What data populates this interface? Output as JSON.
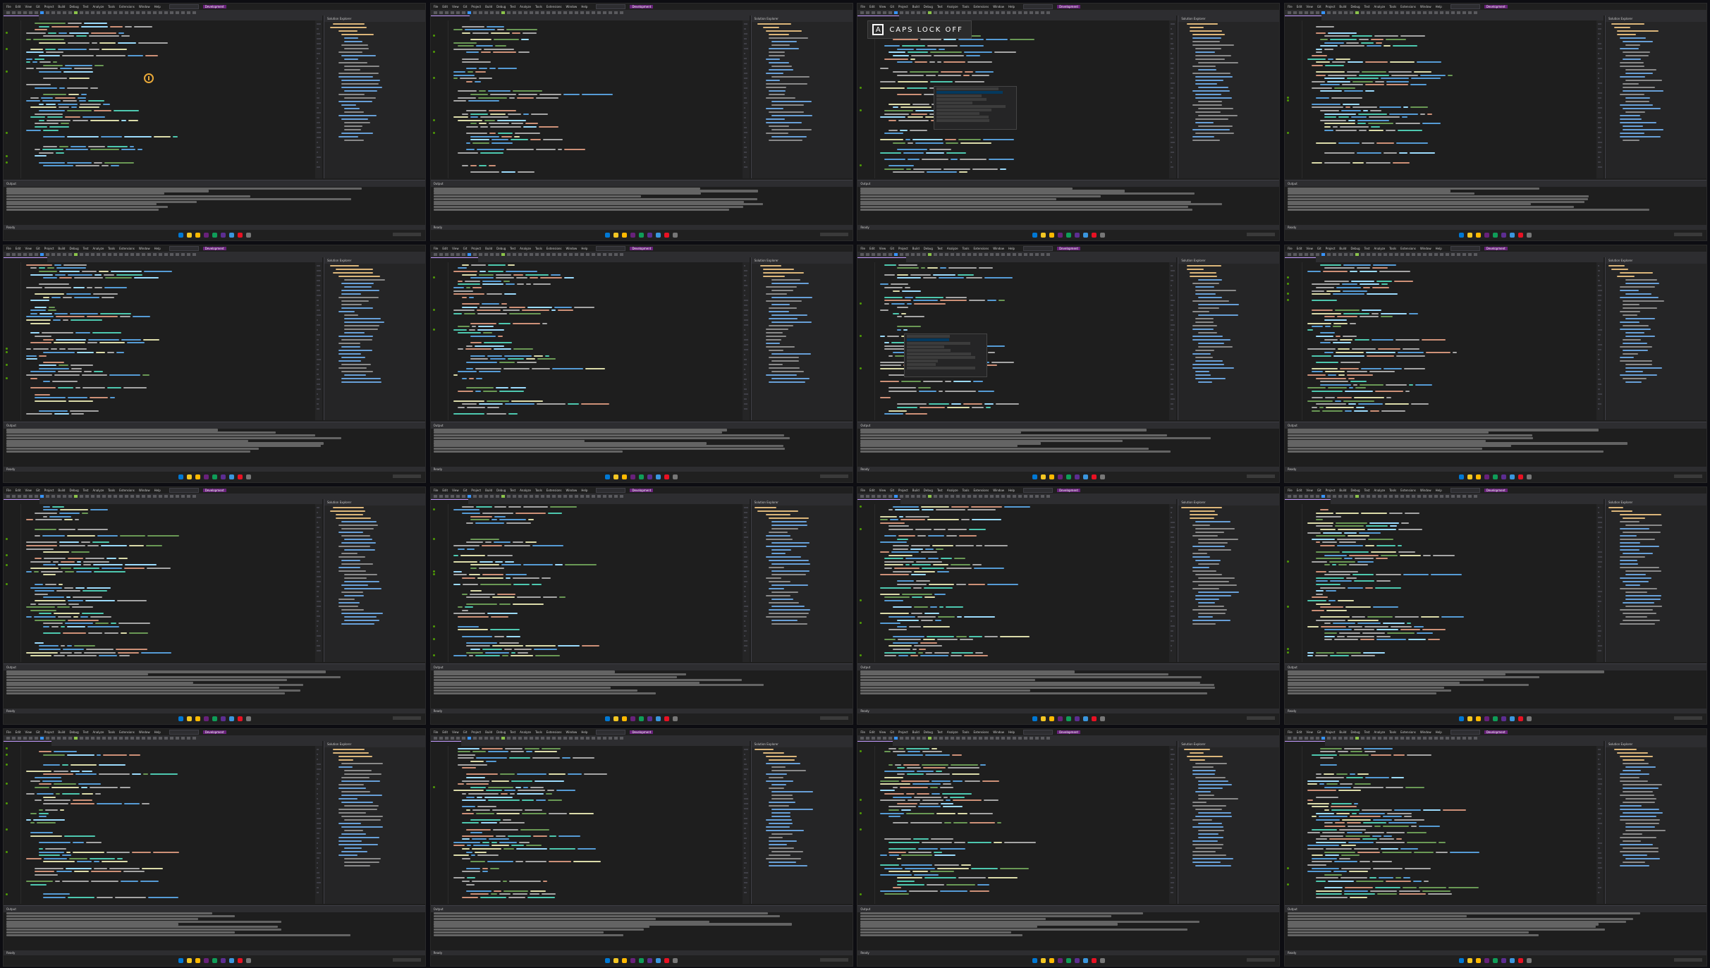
{
  "ide": {
    "menu": [
      "File",
      "Edit",
      "View",
      "Git",
      "Project",
      "Build",
      "Debug",
      "Test",
      "Analyze",
      "Tools",
      "Extensions",
      "Window",
      "Help"
    ],
    "badge": "Development",
    "explorer_title": "Solution Explorer",
    "output_title": "Output",
    "status_text": "Ready",
    "colors": {
      "editor_bg": "#1e1e1e",
      "panel_bg": "#252526",
      "cursor_highlight": "#e8a838",
      "keyword": "#569cd6",
      "type": "#4ec9b0"
    }
  },
  "notification": {
    "text": "CAPS LOCK OFF",
    "icon": "A"
  },
  "frames": [
    {
      "id": 1
    },
    {
      "id": 2
    },
    {
      "id": 3
    },
    {
      "id": 4
    },
    {
      "id": 5
    },
    {
      "id": 6
    },
    {
      "id": 7
    },
    {
      "id": 8
    },
    {
      "id": 9
    },
    {
      "id": 10
    },
    {
      "id": 11
    },
    {
      "id": 12
    },
    {
      "id": 13
    },
    {
      "id": 14
    },
    {
      "id": 15
    },
    {
      "id": 16
    }
  ]
}
